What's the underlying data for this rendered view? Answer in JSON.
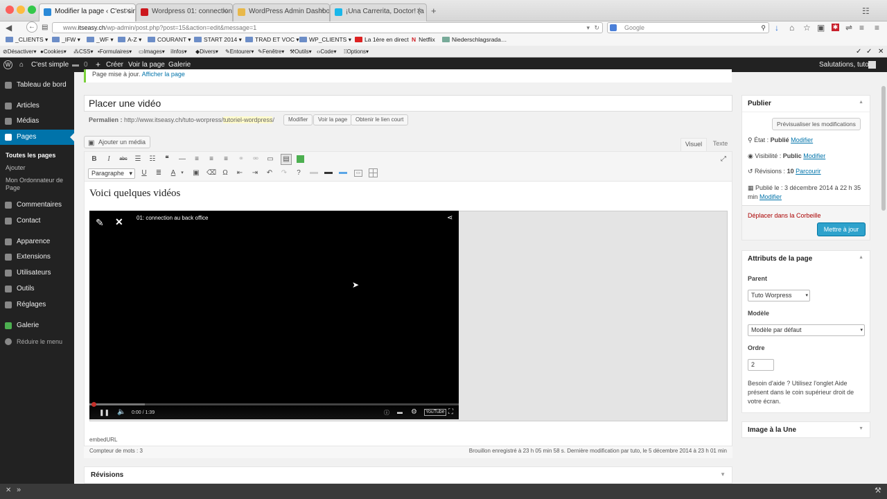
{
  "browser": {
    "tabs": [
      {
        "label": "Modifier la page ‹ C'est simple —…",
        "active": true,
        "color": "#2b8ad8"
      },
      {
        "label": "Wordpress 01: connection a…",
        "active": false,
        "color": "#cc181e"
      },
      {
        "label": "WordPress Admin Dashboar…",
        "active": false,
        "color": "#e8b84a"
      },
      {
        "label": "¡Una Carrerita, Doctor! (a do…",
        "active": false,
        "color": "#1ab7ea"
      }
    ],
    "url_prefix": "www.",
    "url_domain": "itseasy.ch",
    "url_rest": "/wp-admin/post.php?post=15&action=edit&message=1",
    "search_placeholder": "Google",
    "bookmarks": [
      "_CLIENTS",
      "_IFW",
      "_WF",
      "A-Z",
      "COURANT",
      "START 2014",
      "TRAD ET VOC",
      "WP_CLIENTS",
      "La 1ère en direct",
      "Netflix",
      "Niederschlagsrada…"
    ],
    "devtools": [
      "Désactiver",
      "Cookies",
      "CSS",
      "Formulaires",
      "Images",
      "Infos",
      "Divers",
      "Entourer",
      "Fenêtre",
      "Outils",
      "Code",
      "Options"
    ]
  },
  "adminbar": {
    "site": "C'est simple",
    "comments": "0",
    "new": "Créer",
    "view": "Voir la page",
    "gallery": "Galerie",
    "greeting": "Salutations, tuto"
  },
  "sidebar": {
    "items": [
      {
        "label": "Tableau de bord"
      },
      {
        "label": "Articles"
      },
      {
        "label": "Médias"
      },
      {
        "label": "Pages"
      },
      {
        "label": "Commentaires"
      },
      {
        "label": "Contact"
      },
      {
        "label": "Apparence"
      },
      {
        "label": "Extensions"
      },
      {
        "label": "Utilisateurs"
      },
      {
        "label": "Outils"
      },
      {
        "label": "Réglages"
      },
      {
        "label": "Galerie"
      },
      {
        "label": "Réduire le menu"
      }
    ],
    "sub": [
      "Toutes les pages",
      "Ajouter",
      "Mon Ordonnateur de Page"
    ]
  },
  "notice": {
    "text": "Page mise à jour.",
    "link": "Afficher la page"
  },
  "post": {
    "title": "Placer une vidéo",
    "permalink_label": "Permalien :",
    "permalink_base": "http://www.itseasy.ch/tuto-worpress/",
    "permalink_slug": "tutoriel-wordpress",
    "permalink_end": "/",
    "btn_edit": "Modifier",
    "btn_view": "Voir la page",
    "btn_short": "Obtenir le lien court",
    "add_media": "Ajouter un média",
    "tab_visual": "Visuel",
    "tab_text": "Texte",
    "format": "Paragraphe",
    "heading": "Voici quelques vidéos",
    "video_title": "01: connection au back office",
    "video_time": "0:00 / 1:39",
    "embed": "embedURL",
    "wordcount": "Compteur de mots : 3",
    "saved": "Brouillon enregistré à 23 h 05 min 58 s. Dernière modification par tuto, le 5 décembre 2014 à 23 h 01 min",
    "revisions": "Révisions"
  },
  "publish": {
    "title": "Publier",
    "preview": "Prévisualiser les modifications",
    "state_label": "État : ",
    "state_value": "Publié",
    "edit": "Modifier",
    "visibility_label": "Visibilité : ",
    "visibility_value": "Public",
    "revisions_label": "Révisions : ",
    "revisions_value": "10",
    "browse": "Parcourir",
    "published_label": "Publié le : ",
    "published_value": "3 décembre 2014 à 22 h 35 min",
    "trash": "Déplacer dans la Corbeille",
    "update": "Mettre à jour"
  },
  "attributes": {
    "title": "Attributs de la page",
    "parent_label": "Parent",
    "parent_value": "Tuto Worpress",
    "template_label": "Modèle",
    "template_value": "Modèle par défaut",
    "order_label": "Ordre",
    "order_value": "2",
    "help": "Besoin d'aide ? Utilisez l'onglet Aide présent dans le coin supérieur droit de votre écran."
  },
  "featured": {
    "title": "Image à la Une"
  }
}
